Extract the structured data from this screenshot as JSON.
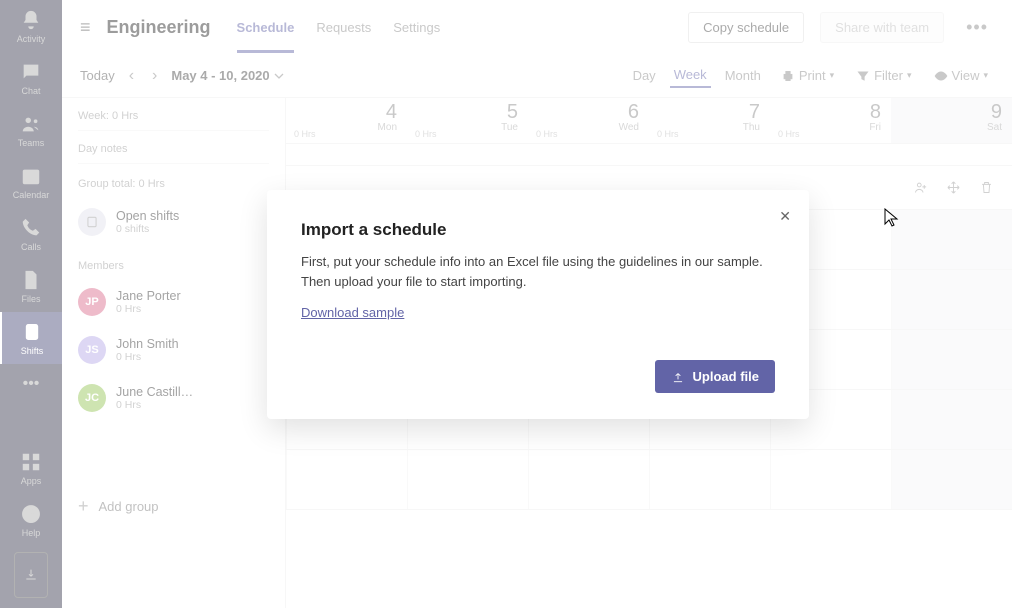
{
  "appbar": {
    "items": [
      {
        "label": "Activity",
        "icon": "bell"
      },
      {
        "label": "Chat",
        "icon": "chat"
      },
      {
        "label": "Teams",
        "icon": "teams"
      },
      {
        "label": "Calendar",
        "icon": "calendar"
      },
      {
        "label": "Calls",
        "icon": "calls"
      },
      {
        "label": "Files",
        "icon": "files"
      },
      {
        "label": "Shifts",
        "icon": "shifts",
        "active": true
      }
    ],
    "apps_label": "Apps",
    "help_label": "Help"
  },
  "topbar": {
    "team_title": "Engineering",
    "tabs": [
      {
        "label": "Schedule",
        "active": true
      },
      {
        "label": "Requests"
      },
      {
        "label": "Settings"
      }
    ],
    "copy_label": "Copy schedule",
    "share_label": "Share with team"
  },
  "secondbar": {
    "today": "Today",
    "date_range": "May 4 - 10, 2020",
    "ranges": [
      {
        "label": "Day"
      },
      {
        "label": "Week",
        "active": true
      },
      {
        "label": "Month"
      }
    ],
    "print": "Print",
    "filter": "Filter",
    "view": "View"
  },
  "sidebar": {
    "week_total": "Week: 0 Hrs",
    "day_notes": "Day notes",
    "group_total": "Group total: 0 Hrs",
    "open_shifts": {
      "title": "Open shifts",
      "sub": "0 shifts"
    },
    "members_label": "Members",
    "members": [
      {
        "name": "Jane Porter",
        "initials": "JP",
        "color": "#d9698b",
        "hrs": "0 Hrs"
      },
      {
        "name": "John Smith",
        "initials": "JS",
        "color": "#b3a7e6",
        "hrs": "0 Hrs"
      },
      {
        "name": "June Castill…",
        "initials": "JC",
        "color": "#92c353",
        "hrs": "0 Hrs"
      }
    ],
    "add_group": "Add group"
  },
  "grid": {
    "days": [
      {
        "num": "4",
        "name": "Mon",
        "hrs": "0 Hrs"
      },
      {
        "num": "5",
        "name": "Tue",
        "hrs": "0 Hrs"
      },
      {
        "num": "6",
        "name": "Wed",
        "hrs": "0 Hrs"
      },
      {
        "num": "7",
        "name": "Thu",
        "hrs": "0 Hrs"
      },
      {
        "num": "8",
        "name": "Fri",
        "hrs": "0 Hrs"
      },
      {
        "num": "9",
        "name": "Sat",
        "hrs": "",
        "weekend": true
      }
    ]
  },
  "modal": {
    "title": "Import a schedule",
    "body": "First, put your schedule info into an Excel file using the guidelines in our sample. Then upload your file to start importing.",
    "link": "Download sample",
    "upload": "Upload file"
  }
}
